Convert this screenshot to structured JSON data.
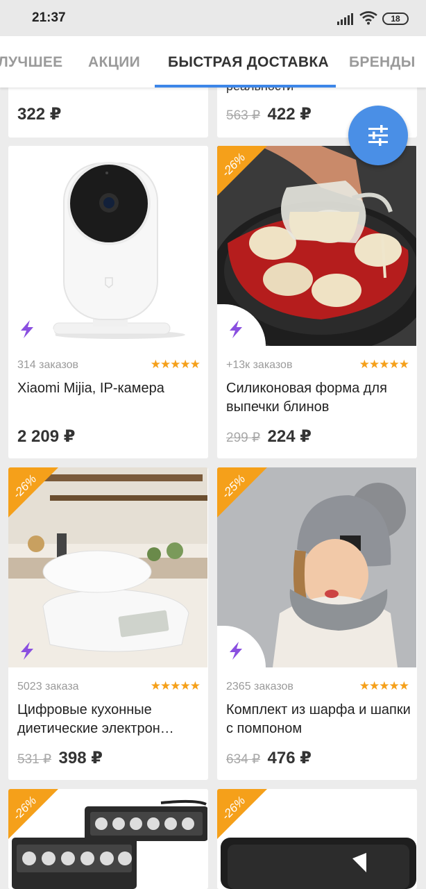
{
  "status_bar": {
    "time": "21:37",
    "battery": "18"
  },
  "tabs": [
    {
      "label": "ЛУЧШЕЕ"
    },
    {
      "label": "АКЦИИ"
    },
    {
      "label": "БЫСТРАЯ ДОСТАВКА"
    },
    {
      "label": "БРЕНДЫ"
    }
  ],
  "top_cards": [
    {
      "price": "322 ₽"
    },
    {
      "title_fragment": "реальности",
      "old_price": "563 ₽",
      "price": "422 ₽"
    }
  ],
  "products": [
    {
      "orders": "314 заказов",
      "stars": "★★★★★",
      "title": "Xiaomi Mijia, IP-камера",
      "price": "2 209 ₽",
      "discount": ""
    },
    {
      "orders": "+13к заказов",
      "stars": "★★★★★",
      "title": "Силиконовая форма для выпечки блинов",
      "old_price": "299 ₽",
      "price": "224 ₽",
      "discount": "-26%"
    },
    {
      "orders": "5023 заказа",
      "stars": "★★★★★",
      "title_line1": "Цифровые кухонные",
      "title_line2": "диетические электрон…",
      "old_price": "531 ₽",
      "price": "398 ₽",
      "discount": "-26%"
    },
    {
      "orders": "2365 заказов",
      "stars": "★★★★★",
      "title": "Комплект из шарфа и шапки с помпоном",
      "old_price": "634 ₽",
      "price": "476 ₽",
      "discount": "-25%"
    }
  ],
  "bottom_cards": [
    {
      "discount": "-26%"
    },
    {
      "discount": "-26%"
    }
  ],
  "colors": {
    "accent": "#3d86e8",
    "fab": "#4a8fe6",
    "discount": "#f5a01a",
    "bolt": "#8a4fe0"
  }
}
